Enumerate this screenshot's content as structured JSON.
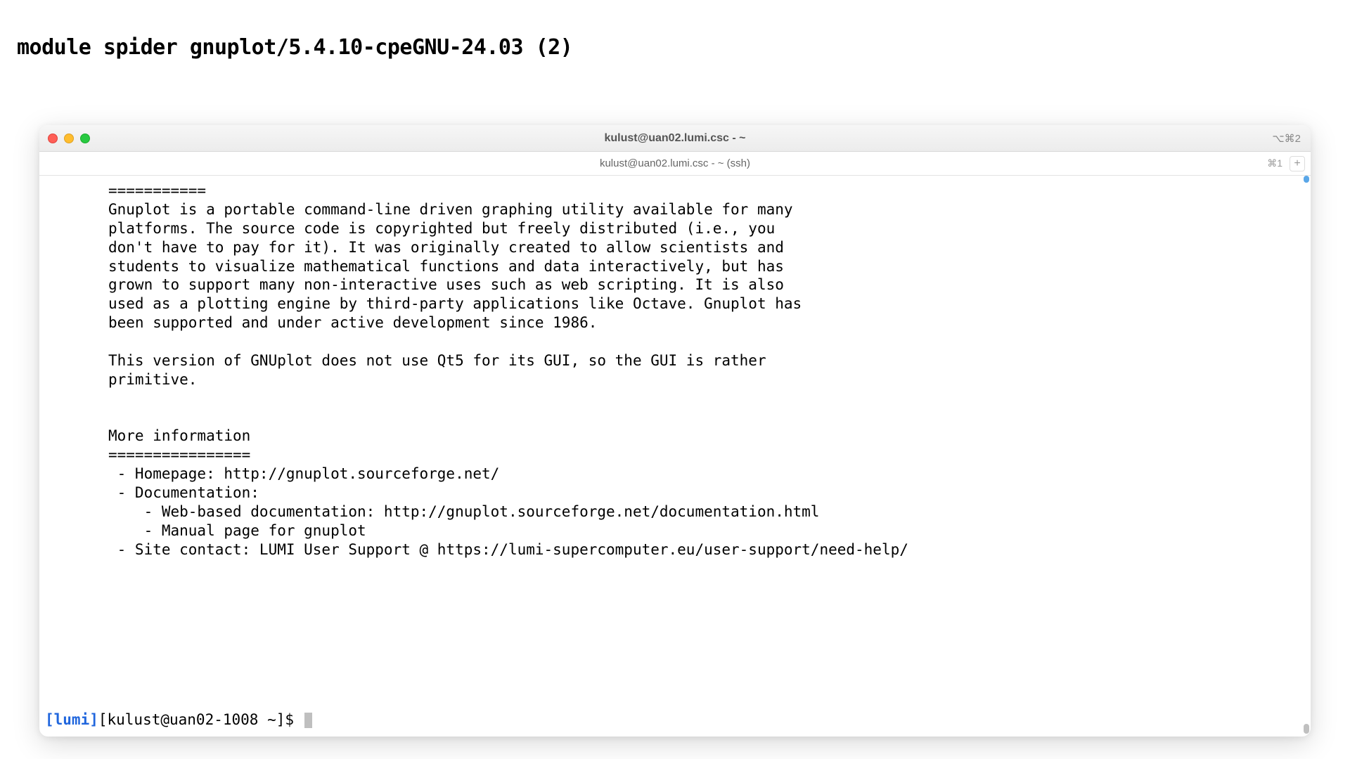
{
  "page": {
    "heading": "module spider gnuplot/5.4.10-cpeGNU-24.03 (2)"
  },
  "window": {
    "title": "kulust@uan02.lumi.csc - ~",
    "right_shortcut": "⌥⌘2"
  },
  "tabbar": {
    "tab_label": "kulust@uan02.lumi.csc - ~ (ssh)",
    "tab_shortcut": "⌘1"
  },
  "terminal": {
    "divider1": "===========",
    "p1_l1": "Gnuplot is a portable command-line driven graphing utility available for many",
    "p1_l2": "platforms. The source code is copyrighted but freely distributed (i.e., you",
    "p1_l3": "don't have to pay for it). It was originally created to allow scientists and",
    "p1_l4": "students to visualize mathematical functions and data interactively, but has",
    "p1_l5": "grown to support many non-interactive uses such as web scripting. It is also",
    "p1_l6": "used as a plotting engine by third-party applications like Octave. Gnuplot has",
    "p1_l7": "been supported and under active development since 1986.",
    "p2_l1": "This version of GNUplot does not use Qt5 for its GUI, so the GUI is rather",
    "p2_l2": "primitive.",
    "moreinfo_header": "More information",
    "divider2": "================",
    "li1": " - Homepage: http://gnuplot.sourceforge.net/",
    "li2": " - Documentation:",
    "li2a": "    - Web-based documentation: http://gnuplot.sourceforge.net/documentation.html",
    "li2b": "    - Manual page for gnuplot",
    "li3": " - Site contact: LUMI User Support @ https://lumi-supercomputer.eu/user-support/need-help/",
    "prompt_host": "[lumi]",
    "prompt_rest": "[kulust@uan02-1008 ~]$ "
  }
}
